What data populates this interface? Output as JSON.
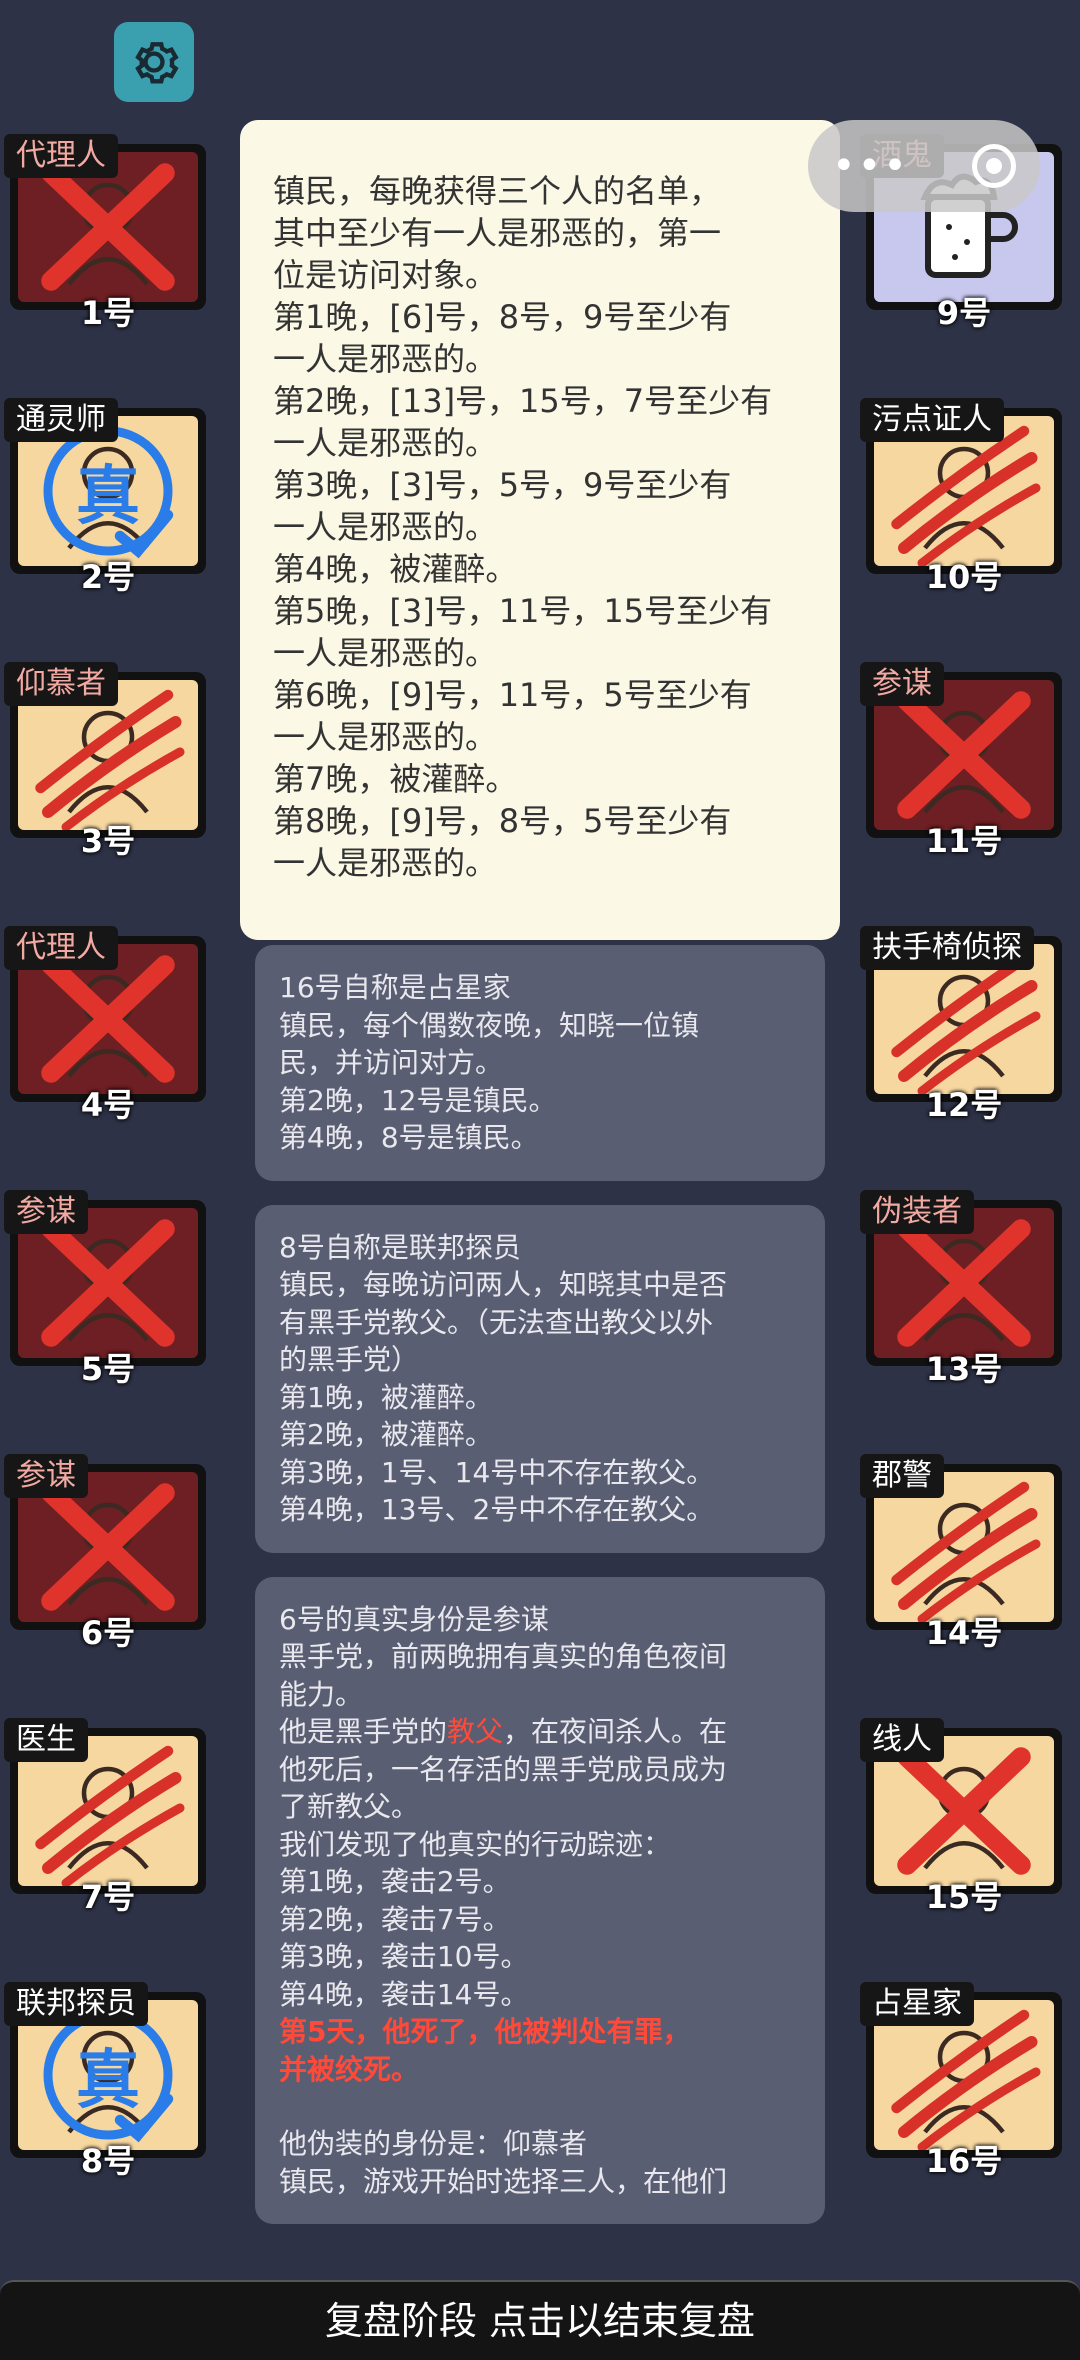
{
  "settings_icon": "gear-icon",
  "players": [
    {
      "id": 1,
      "role": "代理人",
      "number": "1号",
      "state": "dead",
      "mark": "x"
    },
    {
      "id": 2,
      "role": "通灵师",
      "number": "2号",
      "state": "alive",
      "mark": "true-seal"
    },
    {
      "id": 3,
      "role": "仰慕者",
      "number": "3号",
      "state": "alive",
      "mark": "claw"
    },
    {
      "id": 4,
      "role": "代理人",
      "number": "4号",
      "state": "dead",
      "mark": "x"
    },
    {
      "id": 5,
      "role": "参谋",
      "number": "5号",
      "state": "dead",
      "mark": "x"
    },
    {
      "id": 6,
      "role": "参谋",
      "number": "6号",
      "state": "dead",
      "mark": "x"
    },
    {
      "id": 7,
      "role": "医生",
      "number": "7号",
      "state": "alive",
      "mark": "claw"
    },
    {
      "id": 8,
      "role": "联邦探员",
      "number": "8号",
      "state": "alive",
      "mark": "true-seal"
    },
    {
      "id": 9,
      "role": "酒鬼",
      "number": "9号",
      "state": "drunk",
      "mark": "none"
    },
    {
      "id": 10,
      "role": "污点证人",
      "number": "10号",
      "state": "alive",
      "mark": "claw"
    },
    {
      "id": 11,
      "role": "参谋",
      "number": "11号",
      "state": "dead",
      "mark": "x"
    },
    {
      "id": 12,
      "role": "扶手椅侦探",
      "number": "12号",
      "state": "alive",
      "mark": "claw"
    },
    {
      "id": 13,
      "role": "伪装者",
      "number": "13号",
      "state": "dead",
      "mark": "x"
    },
    {
      "id": 14,
      "role": "郡警",
      "number": "14号",
      "state": "alive",
      "mark": "claw"
    },
    {
      "id": 15,
      "role": "线人",
      "number": "15号",
      "state": "alive",
      "mark": "x"
    },
    {
      "id": 16,
      "role": "占星家",
      "number": "16号",
      "state": "alive",
      "mark": "claw"
    }
  ],
  "seal_text": "真",
  "detail_card": {
    "lines": [
      "镇民，每晚获得三个人的名单，",
      "其中至少有一人是邪恶的，第一",
      "位是访问对象。",
      "第1晚，[6]号，8号，9号至少有",
      "一人是邪恶的。",
      "第2晚，[13]号，15号，7号至少有",
      "一人是邪恶的。",
      "第3晚，[3]号，5号，9号至少有",
      "一人是邪恶的。",
      "第4晚，被灌醉。",
      "第5晚，[3]号，11号，15号至少有",
      "一人是邪恶的。",
      "第6晚，[9]号，11号，5号至少有",
      "一人是邪恶的。",
      "第7晚，被灌醉。",
      "第8晚，[9]号，8号，5号至少有",
      "一人是邪恶的。"
    ]
  },
  "cards": [
    {
      "lines": [
        "16号自称是占星家",
        "镇民，每个偶数夜晚，知晓一位镇",
        "民，并访问对方。",
        "第2晚，12号是镇民。",
        "第4晚，8号是镇民。"
      ]
    },
    {
      "lines": [
        "8号自称是联邦探员",
        "镇民，每晚访问两人，知晓其中是否",
        "有黑手党教父。（无法查出教父以外",
        "的黑手党）",
        "第1晚，被灌醉。",
        "第2晚，被灌醉。",
        "第3晚，1号、14号中不存在教父。",
        "第4晚，13号、2号中不存在教父。"
      ]
    },
    {
      "line1": "6号的真实身份是参谋",
      "line2": "黑手党，前两晚拥有真实的角色夜间",
      "line3": "能力。",
      "line4_pre": "他是黑手党的",
      "line4_red": "教父",
      "line4_post": "，在夜间杀人。在",
      "line5": "他死后，一名存活的黑手党成员成为",
      "line6": "了新教父。",
      "line7": "我们发现了他真实的行动踪迹：",
      "line8": "第1晚，袭击2号。",
      "line9": "第2晚，袭击7号。",
      "line10": "第3晚，袭击10号。",
      "line11": "第4晚，袭击14号。",
      "death1": "第5天，他死了，他被判处有罪，",
      "death2": "并被绞死。",
      "fake_role": "他伪装的身份是：仰慕者",
      "fake_desc": "镇民，游戏开始时选择三人，在他们"
    }
  ],
  "bottom_bar": "复盘阶段 点击以结束复盘"
}
